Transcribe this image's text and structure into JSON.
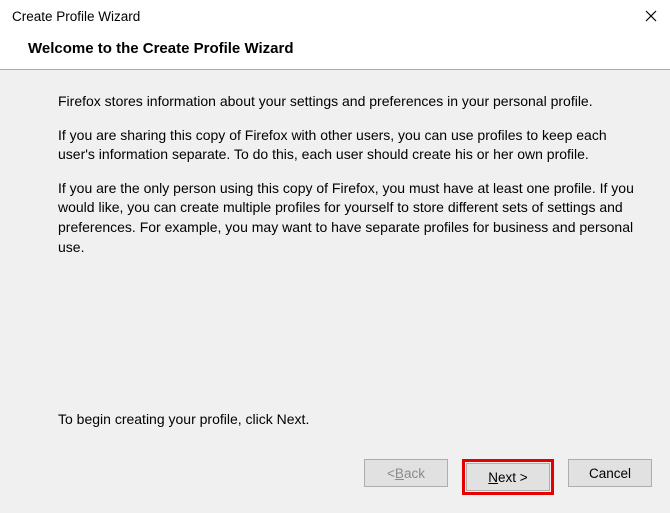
{
  "window": {
    "title": "Create Profile Wizard"
  },
  "header": {
    "heading": "Welcome to the Create Profile Wizard"
  },
  "body": {
    "para1": "Firefox stores information about your settings and preferences in your personal profile.",
    "para2": "If you are sharing this copy of Firefox with other users, you can use profiles to keep each user's information separate. To do this, each user should create his or her own profile.",
    "para3": "If you are the only person using this copy of Firefox, you must have at least one profile. If you would like, you can create multiple profiles for yourself to store different sets of settings and preferences. For example, you may want to have separate profiles for business and personal use.",
    "begin": "To begin creating your profile, click Next."
  },
  "buttons": {
    "back_prefix": "< ",
    "back_mnemonic": "B",
    "back_suffix": "ack",
    "next_mnemonic": "N",
    "next_suffix": "ext >",
    "cancel": "Cancel"
  }
}
